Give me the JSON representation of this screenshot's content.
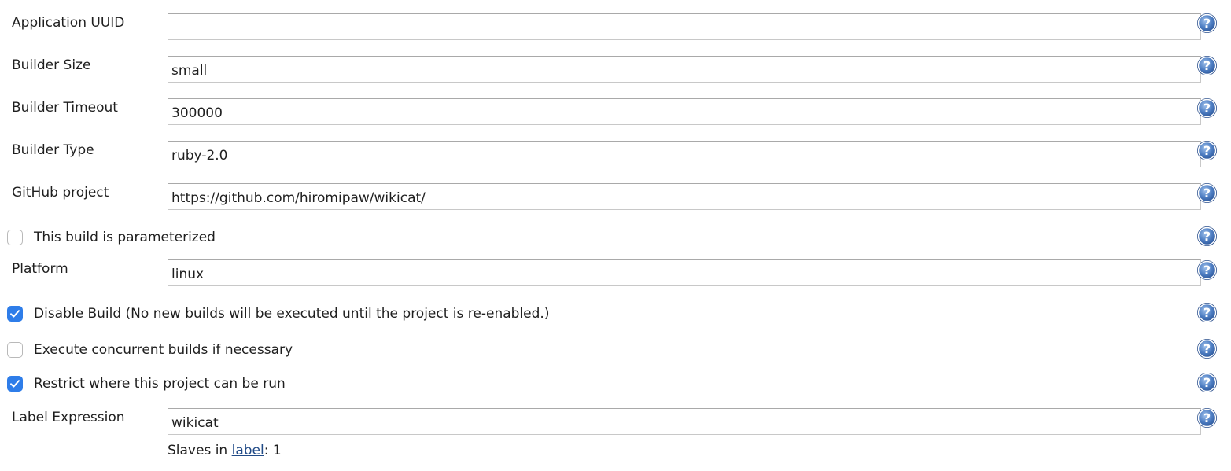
{
  "fields": [
    {
      "label": "Application UUID",
      "value": ""
    },
    {
      "label": "Builder Size",
      "value": "small"
    },
    {
      "label": "Builder Timeout",
      "value": "300000"
    },
    {
      "label": "Builder Type",
      "value": "ruby-2.0"
    },
    {
      "label": "GitHub project",
      "value": "https://github.com/hiromipaw/wikicat/"
    }
  ],
  "parameterized": {
    "label": "This build is parameterized",
    "checked": false
  },
  "platform": {
    "label": "Platform",
    "value": "linux"
  },
  "disable_build": {
    "label": "Disable Build (No new builds will be executed until the project is re-enabled.)",
    "checked": true
  },
  "concurrent": {
    "label": "Execute concurrent builds if necessary",
    "checked": false
  },
  "restrict": {
    "label": "Restrict where this project can be run",
    "checked": true
  },
  "label_expression": {
    "label": "Label Expression",
    "value": "wikicat"
  },
  "slaves": {
    "prefix": "Slaves in",
    "link": "label",
    "suffix": ": 1"
  },
  "icons": {
    "help": "help-icon",
    "check": "checkmark-icon"
  },
  "colors": {
    "accent": "#2e7de9",
    "link": "#204a87",
    "help_blue": "#3b6ab0"
  }
}
